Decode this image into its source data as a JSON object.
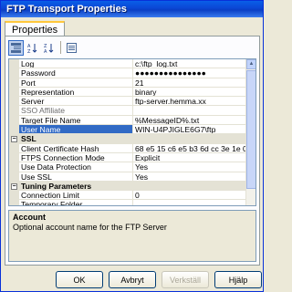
{
  "window": {
    "title": "FTP Transport Properties"
  },
  "tabs": [
    {
      "label": "Properties"
    }
  ],
  "toolbar": {
    "icons": [
      "categorized-icon",
      "sort-az-icon",
      "sort-za-icon",
      "property-pages-icon"
    ]
  },
  "grid": {
    "rows": [
      {
        "kind": "prop",
        "name": "Log",
        "value": "c:\\ftp_log.txt"
      },
      {
        "kind": "prop",
        "name": "Password",
        "value": "●●●●●●●●●●●●●●●"
      },
      {
        "kind": "prop",
        "name": "Port",
        "value": "21"
      },
      {
        "kind": "prop",
        "name": "Representation",
        "value": "binary"
      },
      {
        "kind": "prop",
        "name": "Server",
        "value": "ftp-server.hemma.xx"
      },
      {
        "kind": "prop",
        "name": "SSO Affiliate",
        "value": "",
        "dim": true
      },
      {
        "kind": "prop",
        "name": "Target File Name",
        "value": "%MessageID%.txt"
      },
      {
        "kind": "prop",
        "name": "User Name",
        "value": "WIN-U4PJIGLE6G7\\ftp",
        "selected": true
      },
      {
        "kind": "cat",
        "name": "SSL"
      },
      {
        "kind": "prop",
        "name": "Client Certificate Hash",
        "value": "68 e5 15 c6 e5 b3 6d cc 3e 1e 0"
      },
      {
        "kind": "prop",
        "name": "FTPS Connection Mode",
        "value": "Explicit"
      },
      {
        "kind": "prop",
        "name": "Use Data Protection",
        "value": "Yes"
      },
      {
        "kind": "prop",
        "name": "Use SSL",
        "value": "Yes"
      },
      {
        "kind": "cat",
        "name": "Tuning Parameters"
      },
      {
        "kind": "prop",
        "name": "Connection Limit",
        "value": "0"
      },
      {
        "kind": "prop",
        "name": "Temporary Folder",
        "value": ""
      }
    ]
  },
  "description": {
    "title": "Account",
    "text": "Optional account name for the FTP Server"
  },
  "buttons": {
    "ok": "OK",
    "cancel": "Avbryt",
    "apply": "Verkställ",
    "help": "Hjälp"
  }
}
